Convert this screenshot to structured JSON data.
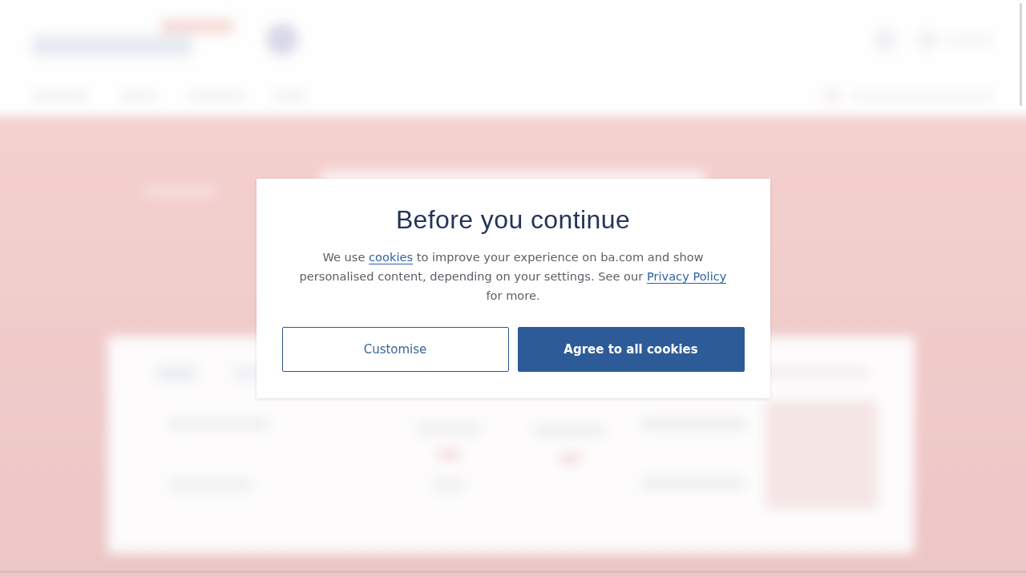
{
  "cookie_dialog": {
    "title": "Before you continue",
    "message": [
      {
        "kind": "text",
        "text": "We use "
      },
      {
        "kind": "link",
        "text": "cookies"
      },
      {
        "kind": "text",
        "text": " to improve your experience on ba.com and show personalised content, depending on your settings. See our "
      },
      {
        "kind": "link",
        "text": "Privacy Policy"
      },
      {
        "kind": "text",
        "text": " for more."
      }
    ],
    "buttons": [
      {
        "kind": "secondary",
        "label": "Customise"
      },
      {
        "kind": "primary",
        "label": "Agree to all cookies"
      }
    ]
  }
}
